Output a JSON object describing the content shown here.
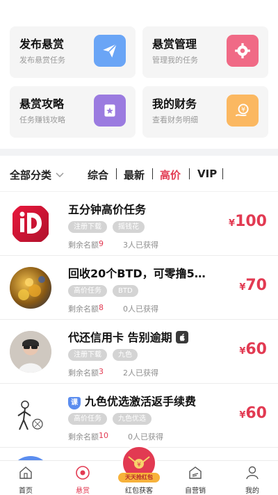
{
  "cards": [
    {
      "title": "发布悬赏",
      "subtitle": "发布悬赏任务",
      "icon": "paper-plane-icon",
      "color": "#6aa5f6"
    },
    {
      "title": "悬赏管理",
      "subtitle": "管理我的任务",
      "icon": "gear-icon",
      "color": "#f06a86"
    },
    {
      "title": "悬赏攻略",
      "subtitle": "任务赚钱攻略",
      "icon": "star-bookmark-icon",
      "color": "#9b7be0"
    },
    {
      "title": "我的财务",
      "subtitle": "查看财务明细",
      "icon": "yuan-hand-icon",
      "color": "#fbb861"
    }
  ],
  "filter": {
    "all_label": "全部分类",
    "tabs": [
      "综合",
      "最新",
      "高价",
      "VIP"
    ],
    "active_tab": "高价"
  },
  "list": [
    {
      "title": "五分钟高价任务",
      "tags": [
        "注册下载",
        "摇钱花"
      ],
      "remaining_label": "剩余名额",
      "remaining": "9",
      "obtained": "3人已获得",
      "currency": "¥",
      "price": "100",
      "avatar": "red-logo"
    },
    {
      "title": "回收20个BTD，可零撸5…",
      "tags": [
        "高价任务",
        "BTD"
      ],
      "remaining_label": "剩余名额",
      "remaining": "8",
      "obtained": "0人已获得",
      "currency": "¥",
      "price": "70",
      "avatar": "coins-photo"
    },
    {
      "title": "代还信用卡 告别逾期",
      "tags": [
        "注册下载",
        "九色"
      ],
      "remaining_label": "剩余名额",
      "remaining": "3",
      "obtained": "2人已获得",
      "currency": "¥",
      "price": "60",
      "avatar": "person-photo"
    },
    {
      "title": "九色优选激活返手续费",
      "tags": [
        "高价任务",
        "九色优选"
      ],
      "remaining_label": "剩余名额",
      "remaining": "10",
      "obtained": "0人已获得",
      "currency": "¥",
      "price": "60",
      "avatar": "sketch-photo",
      "badge": "课"
    }
  ],
  "nav": [
    {
      "label": "首页",
      "icon": "home-icon"
    },
    {
      "label": "悬赏",
      "icon": "reward-icon"
    },
    {
      "label": "红包获客",
      "icon": "red-packet-icon"
    },
    {
      "label": "自营销",
      "icon": "marketing-icon"
    },
    {
      "label": "我的",
      "icon": "profile-icon"
    }
  ],
  "nav_active": "悬赏",
  "center_tag": "天天抢红包"
}
